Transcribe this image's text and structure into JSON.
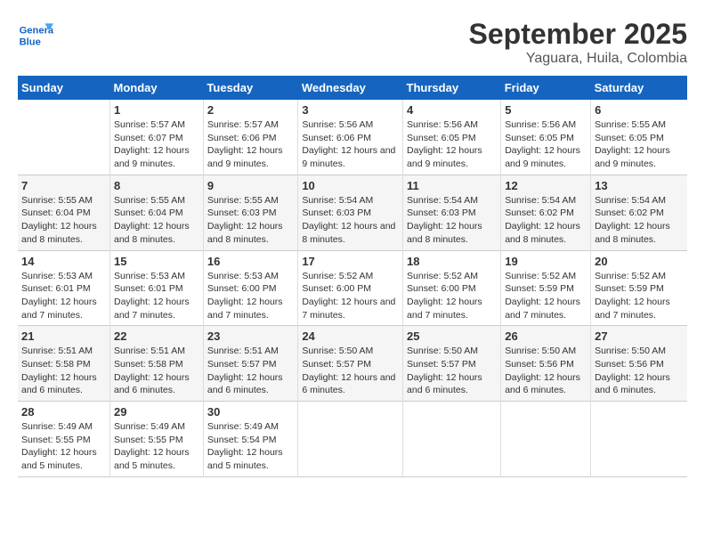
{
  "logo": {
    "line1": "General",
    "line2": "Blue"
  },
  "title": "September 2025",
  "subtitle": "Yaguara, Huila, Colombia",
  "days_of_week": [
    "Sunday",
    "Monday",
    "Tuesday",
    "Wednesday",
    "Thursday",
    "Friday",
    "Saturday"
  ],
  "weeks": [
    [
      {
        "day": "",
        "sunrise": "",
        "sunset": "",
        "daylight": ""
      },
      {
        "day": "1",
        "sunrise": "Sunrise: 5:57 AM",
        "sunset": "Sunset: 6:07 PM",
        "daylight": "Daylight: 12 hours and 9 minutes."
      },
      {
        "day": "2",
        "sunrise": "Sunrise: 5:57 AM",
        "sunset": "Sunset: 6:06 PM",
        "daylight": "Daylight: 12 hours and 9 minutes."
      },
      {
        "day": "3",
        "sunrise": "Sunrise: 5:56 AM",
        "sunset": "Sunset: 6:06 PM",
        "daylight": "Daylight: 12 hours and 9 minutes."
      },
      {
        "day": "4",
        "sunrise": "Sunrise: 5:56 AM",
        "sunset": "Sunset: 6:05 PM",
        "daylight": "Daylight: 12 hours and 9 minutes."
      },
      {
        "day": "5",
        "sunrise": "Sunrise: 5:56 AM",
        "sunset": "Sunset: 6:05 PM",
        "daylight": "Daylight: 12 hours and 9 minutes."
      },
      {
        "day": "6",
        "sunrise": "Sunrise: 5:55 AM",
        "sunset": "Sunset: 6:05 PM",
        "daylight": "Daylight: 12 hours and 9 minutes."
      }
    ],
    [
      {
        "day": "7",
        "sunrise": "Sunrise: 5:55 AM",
        "sunset": "Sunset: 6:04 PM",
        "daylight": "Daylight: 12 hours and 8 minutes."
      },
      {
        "day": "8",
        "sunrise": "Sunrise: 5:55 AM",
        "sunset": "Sunset: 6:04 PM",
        "daylight": "Daylight: 12 hours and 8 minutes."
      },
      {
        "day": "9",
        "sunrise": "Sunrise: 5:55 AM",
        "sunset": "Sunset: 6:03 PM",
        "daylight": "Daylight: 12 hours and 8 minutes."
      },
      {
        "day": "10",
        "sunrise": "Sunrise: 5:54 AM",
        "sunset": "Sunset: 6:03 PM",
        "daylight": "Daylight: 12 hours and 8 minutes."
      },
      {
        "day": "11",
        "sunrise": "Sunrise: 5:54 AM",
        "sunset": "Sunset: 6:03 PM",
        "daylight": "Daylight: 12 hours and 8 minutes."
      },
      {
        "day": "12",
        "sunrise": "Sunrise: 5:54 AM",
        "sunset": "Sunset: 6:02 PM",
        "daylight": "Daylight: 12 hours and 8 minutes."
      },
      {
        "day": "13",
        "sunrise": "Sunrise: 5:54 AM",
        "sunset": "Sunset: 6:02 PM",
        "daylight": "Daylight: 12 hours and 8 minutes."
      }
    ],
    [
      {
        "day": "14",
        "sunrise": "Sunrise: 5:53 AM",
        "sunset": "Sunset: 6:01 PM",
        "daylight": "Daylight: 12 hours and 7 minutes."
      },
      {
        "day": "15",
        "sunrise": "Sunrise: 5:53 AM",
        "sunset": "Sunset: 6:01 PM",
        "daylight": "Daylight: 12 hours and 7 minutes."
      },
      {
        "day": "16",
        "sunrise": "Sunrise: 5:53 AM",
        "sunset": "Sunset: 6:00 PM",
        "daylight": "Daylight: 12 hours and 7 minutes."
      },
      {
        "day": "17",
        "sunrise": "Sunrise: 5:52 AM",
        "sunset": "Sunset: 6:00 PM",
        "daylight": "Daylight: 12 hours and 7 minutes."
      },
      {
        "day": "18",
        "sunrise": "Sunrise: 5:52 AM",
        "sunset": "Sunset: 6:00 PM",
        "daylight": "Daylight: 12 hours and 7 minutes."
      },
      {
        "day": "19",
        "sunrise": "Sunrise: 5:52 AM",
        "sunset": "Sunset: 5:59 PM",
        "daylight": "Daylight: 12 hours and 7 minutes."
      },
      {
        "day": "20",
        "sunrise": "Sunrise: 5:52 AM",
        "sunset": "Sunset: 5:59 PM",
        "daylight": "Daylight: 12 hours and 7 minutes."
      }
    ],
    [
      {
        "day": "21",
        "sunrise": "Sunrise: 5:51 AM",
        "sunset": "Sunset: 5:58 PM",
        "daylight": "Daylight: 12 hours and 6 minutes."
      },
      {
        "day": "22",
        "sunrise": "Sunrise: 5:51 AM",
        "sunset": "Sunset: 5:58 PM",
        "daylight": "Daylight: 12 hours and 6 minutes."
      },
      {
        "day": "23",
        "sunrise": "Sunrise: 5:51 AM",
        "sunset": "Sunset: 5:57 PM",
        "daylight": "Daylight: 12 hours and 6 minutes."
      },
      {
        "day": "24",
        "sunrise": "Sunrise: 5:50 AM",
        "sunset": "Sunset: 5:57 PM",
        "daylight": "Daylight: 12 hours and 6 minutes."
      },
      {
        "day": "25",
        "sunrise": "Sunrise: 5:50 AM",
        "sunset": "Sunset: 5:57 PM",
        "daylight": "Daylight: 12 hours and 6 minutes."
      },
      {
        "day": "26",
        "sunrise": "Sunrise: 5:50 AM",
        "sunset": "Sunset: 5:56 PM",
        "daylight": "Daylight: 12 hours and 6 minutes."
      },
      {
        "day": "27",
        "sunrise": "Sunrise: 5:50 AM",
        "sunset": "Sunset: 5:56 PM",
        "daylight": "Daylight: 12 hours and 6 minutes."
      }
    ],
    [
      {
        "day": "28",
        "sunrise": "Sunrise: 5:49 AM",
        "sunset": "Sunset: 5:55 PM",
        "daylight": "Daylight: 12 hours and 5 minutes."
      },
      {
        "day": "29",
        "sunrise": "Sunrise: 5:49 AM",
        "sunset": "Sunset: 5:55 PM",
        "daylight": "Daylight: 12 hours and 5 minutes."
      },
      {
        "day": "30",
        "sunrise": "Sunrise: 5:49 AM",
        "sunset": "Sunset: 5:54 PM",
        "daylight": "Daylight: 12 hours and 5 minutes."
      },
      {
        "day": "",
        "sunrise": "",
        "sunset": "",
        "daylight": ""
      },
      {
        "day": "",
        "sunrise": "",
        "sunset": "",
        "daylight": ""
      },
      {
        "day": "",
        "sunrise": "",
        "sunset": "",
        "daylight": ""
      },
      {
        "day": "",
        "sunrise": "",
        "sunset": "",
        "daylight": ""
      }
    ]
  ]
}
